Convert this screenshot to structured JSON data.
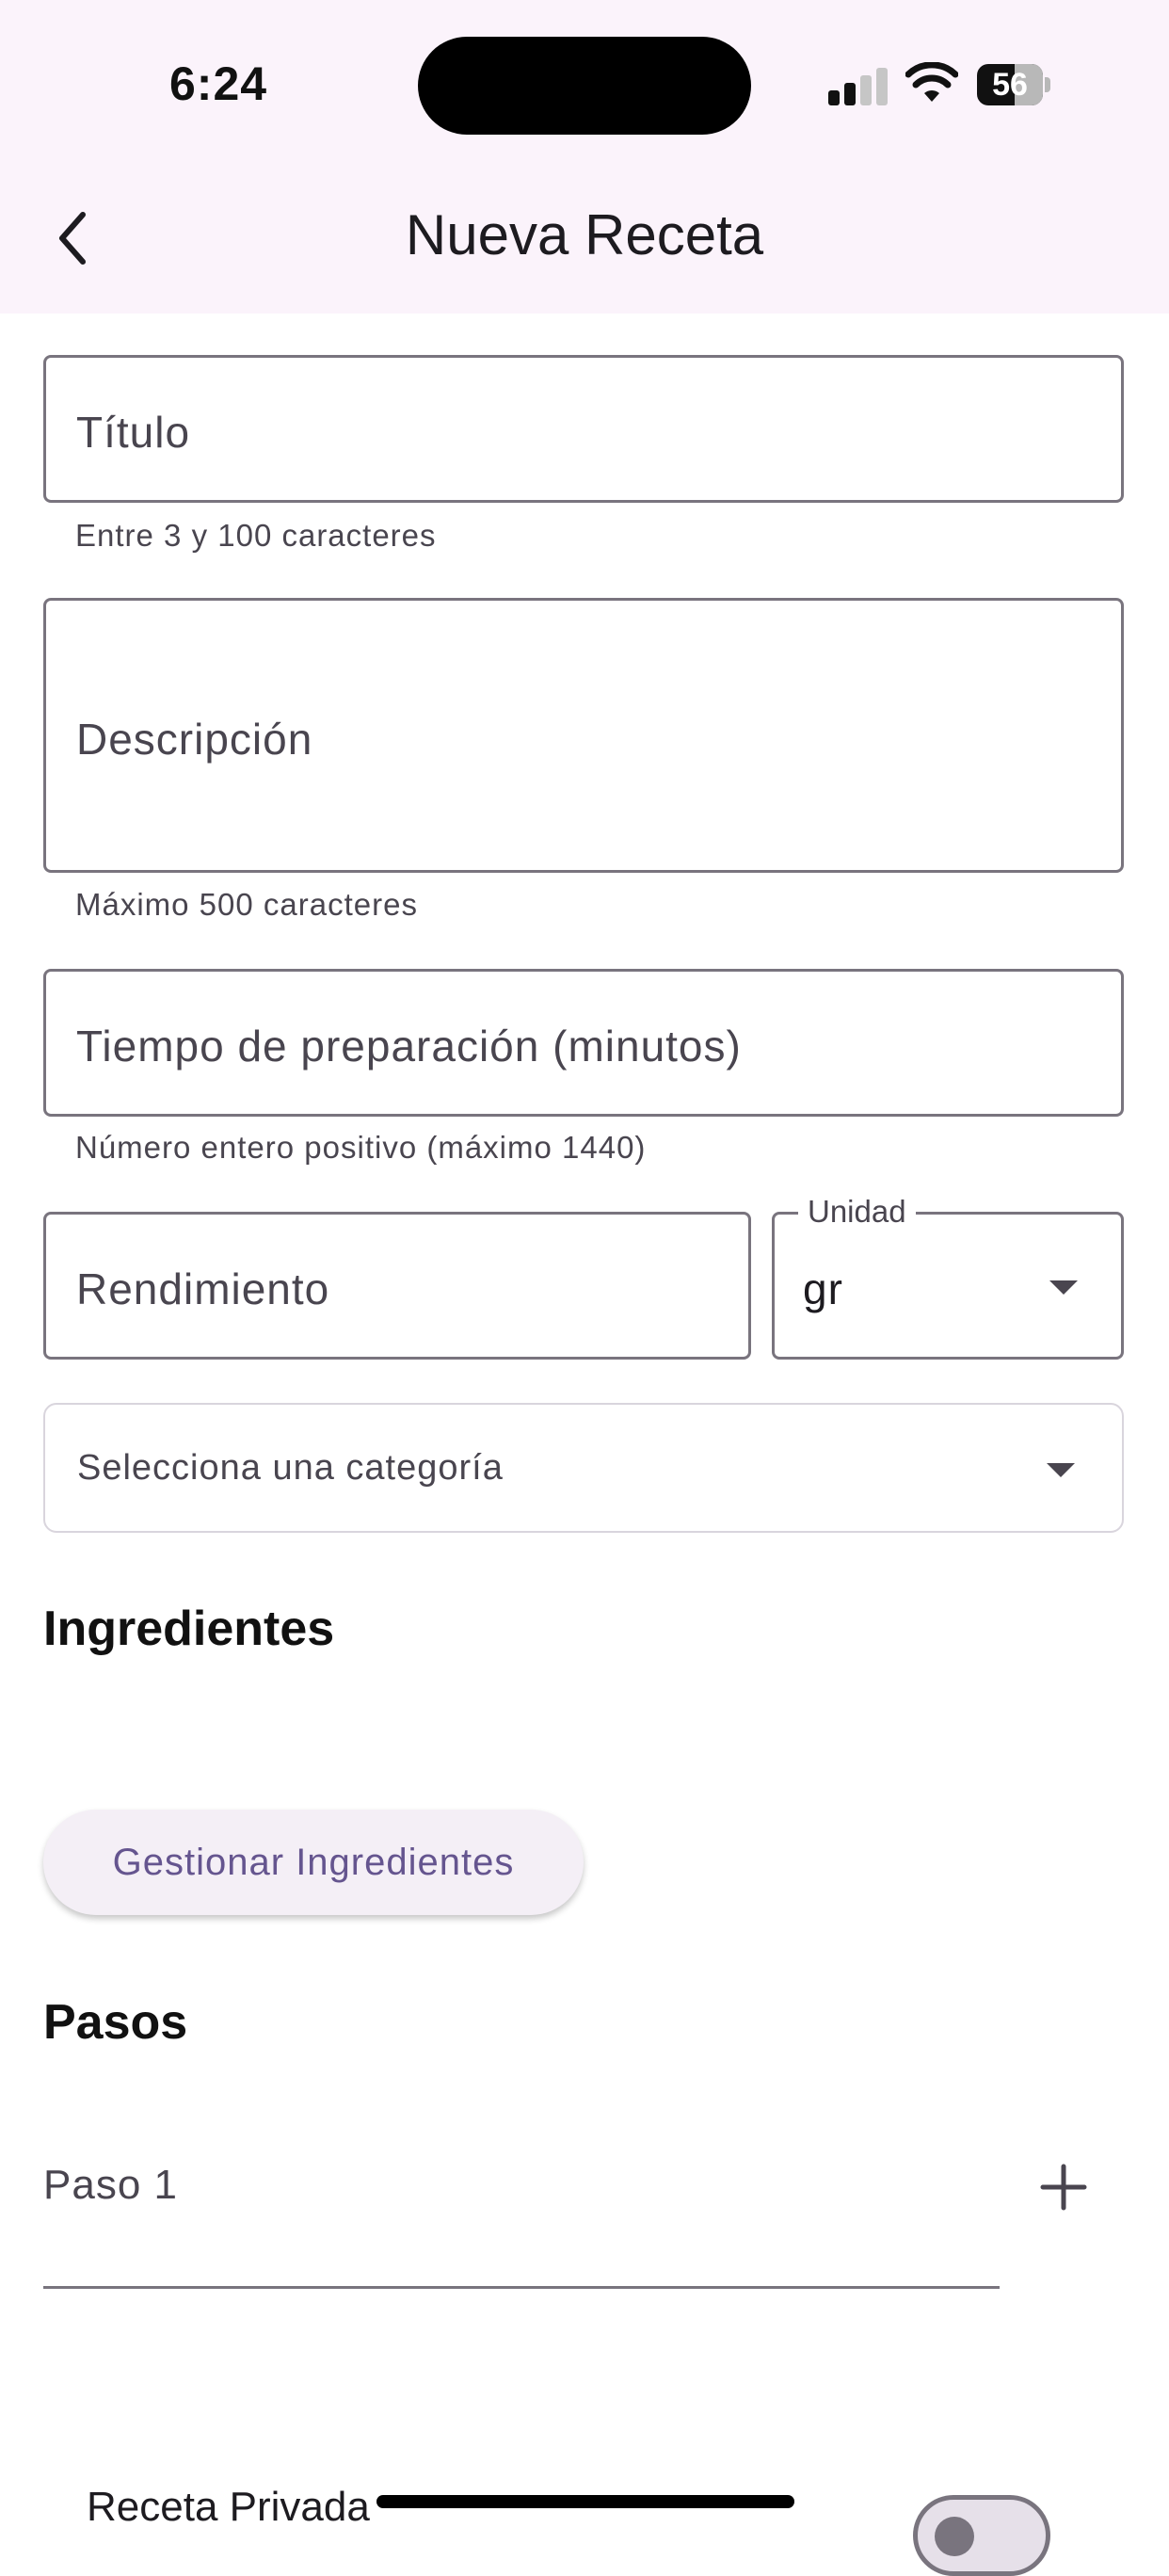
{
  "status_bar": {
    "time": "6:24",
    "battery": "56"
  },
  "header": {
    "title": "Nueva Receta"
  },
  "form": {
    "titulo": {
      "label": "Título",
      "helper": "Entre 3 y 100 caracteres"
    },
    "descripcion": {
      "label": "Descripción",
      "helper": "Máximo 500 caracteres"
    },
    "tiempo": {
      "label": "Tiempo de preparación (minutos)",
      "helper": "Número entero positivo (máximo 1440)"
    },
    "rendimiento": {
      "label": "Rendimiento"
    },
    "unidad": {
      "label": "Unidad",
      "value": "gr"
    },
    "categoria": {
      "placeholder": "Selecciona una categoría"
    }
  },
  "ingredientes": {
    "heading": "Ingredientes",
    "button": "Gestionar Ingredientes"
  },
  "pasos": {
    "heading": "Pasos",
    "step_label": "Paso 1"
  },
  "privada": {
    "label": "Receta Privada",
    "enabled": false
  },
  "colors": {
    "appbar_bg": "#fbf3fb",
    "accent": "#65558f",
    "outline": "#79747e"
  }
}
